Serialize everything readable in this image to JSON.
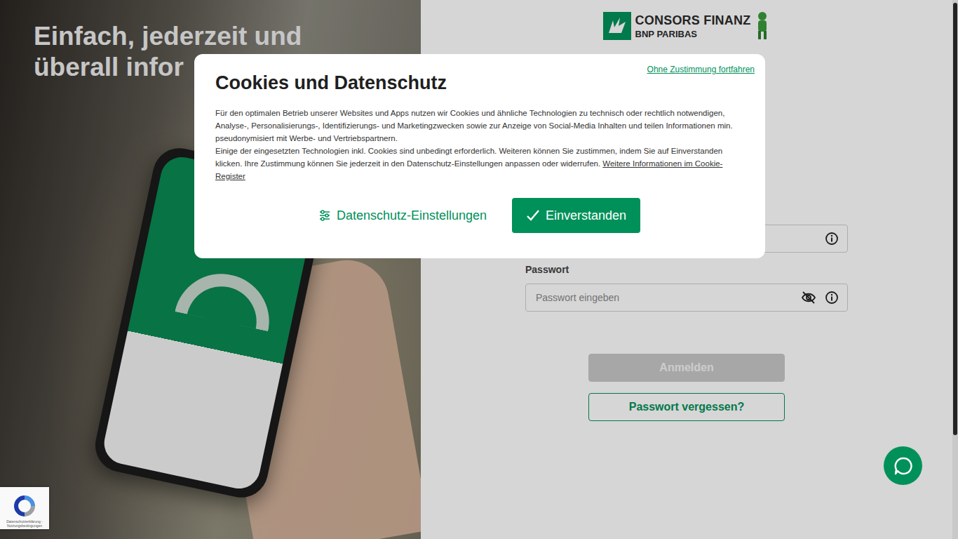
{
  "hero": {
    "headline": [
      "Einfach, jederzeit und",
      "überall infor"
    ]
  },
  "logo": {
    "name": "CONSORS FINANZ",
    "sub": "BNP PARIBAS"
  },
  "login": {
    "password_label": "Passwort",
    "password_placeholder": "Passwort eingeben",
    "buttons": [
      {
        "label": "Anmelden",
        "disabled": true,
        "kind": "primary"
      },
      {
        "label": "Passwort vergessen?",
        "disabled": false,
        "kind": "outline"
      }
    ]
  },
  "cookie": {
    "skip": "Ohne Zustimmung fortfahren",
    "title": "Cookies und Datenschutz",
    "paragraph1": "Für den optimalen Betrieb unserer Websites und Apps nutzen wir Cookies und ähnliche Technologien zu technisch oder rechtlich notwendigen, Analyse-, Personalisierungs-, Identifizierungs- und Marketingzwecken sowie zur Anzeige von Social-Media Inhalten und teilen Informationen min. pseudonymisiert mit Werbe- und Vertriebspartnern.",
    "paragraph2": "Einige der eingesetzten Technologien inkl. Cookies sind unbedingt erforderlich. Weiteren können Sie zustimmen, indem Sie auf Einverstanden klicken. Ihre Zustimmung können Sie jederzeit in den Datenschutz-Einstellungen anpassen oder widerrufen.",
    "link": "Weitere Informationen im Cookie-Register",
    "settings": "Datenschutz-Einstellungen",
    "accept": "Einverstanden"
  },
  "recaptcha": {
    "text": "Datenschutzerklärung - Nutzungsbedingungen"
  }
}
